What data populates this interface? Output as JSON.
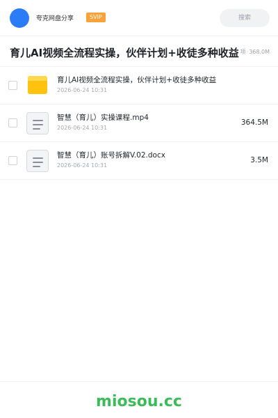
{
  "header": {
    "user_name": "夸克网盘分享",
    "badge": "SVIP",
    "search_placeholder": "搜索"
  },
  "title_bar": {
    "title": "育儿AI视频全流程实操，伙伴计划+收徒多种收益",
    "meta_count": "项",
    "meta_separator": "·",
    "meta_size": "368.0M"
  },
  "files": [
    {
      "name": "育儿AI视频全流程实操，伙伴计划+收徒多种收益",
      "date": "2026-06-24 10:31",
      "size": "",
      "type": "folder"
    },
    {
      "name": "智慧（育儿）实操课程.mp4",
      "date": "2026-06-24 10:31",
      "size": "364.5M",
      "type": "video"
    },
    {
      "name": "智慧（育儿）账号拆解V.02.docx",
      "date": "2026-06-24 10:31",
      "size": "3.5M",
      "type": "document"
    }
  ],
  "footer": {
    "watermark": "miosou.cc"
  },
  "colors": {
    "accent": "#2b7cf6",
    "svip": "#f7a33a",
    "folder": "#ffc20f",
    "watermark": "#3dbb5a"
  }
}
